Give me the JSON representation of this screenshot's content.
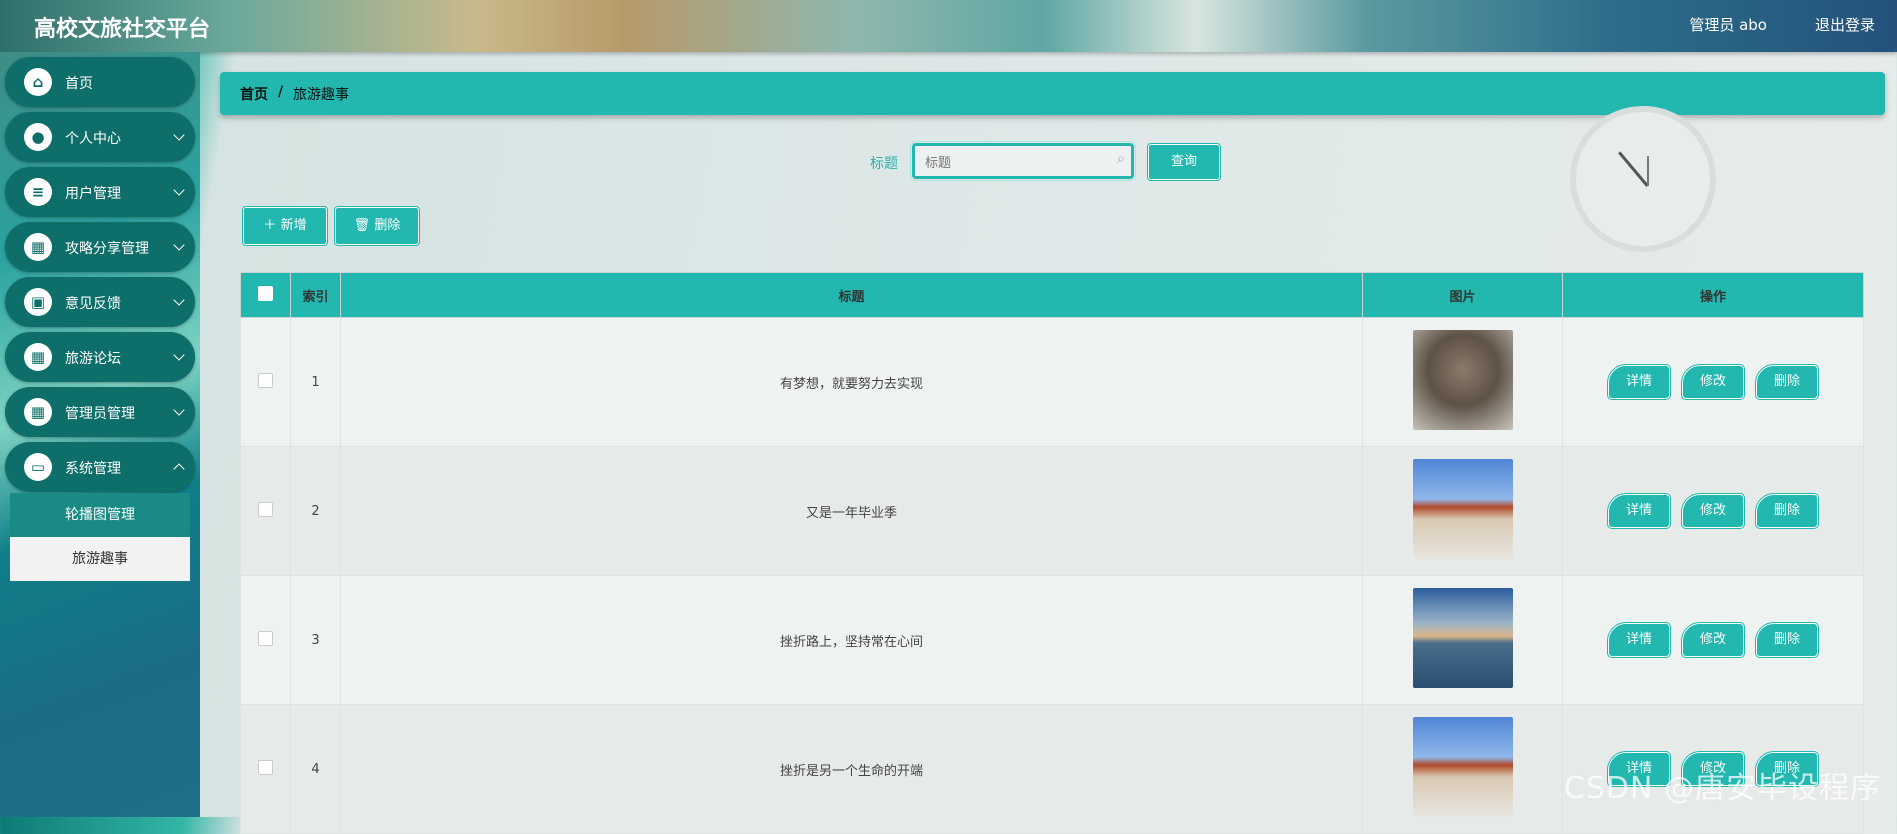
{
  "header": {
    "title": "高校文旅社交平台",
    "admin": "管理员 abo",
    "logout": "退出登录"
  },
  "sidebar": {
    "items": [
      {
        "label": "首页",
        "icon": "home-icon",
        "glyph": "⌂",
        "expandable": false
      },
      {
        "label": "个人中心",
        "icon": "user-icon",
        "glyph": "●",
        "expandable": true
      },
      {
        "label": "用户管理",
        "icon": "list-icon",
        "glyph": "≡",
        "expandable": true
      },
      {
        "label": "攻略分享管理",
        "icon": "grid-icon",
        "glyph": "▦",
        "expandable": true
      },
      {
        "label": "意见反馈",
        "icon": "briefcase-icon",
        "glyph": "▣",
        "expandable": true
      },
      {
        "label": "旅游论坛",
        "icon": "grid-icon",
        "glyph": "▦",
        "expandable": true
      },
      {
        "label": "管理员管理",
        "icon": "grid-icon",
        "glyph": "▦",
        "expandable": true
      },
      {
        "label": "系统管理",
        "icon": "monitor-icon",
        "glyph": "▭",
        "expandable": true
      }
    ],
    "submenu": [
      {
        "label": "轮播图管理"
      },
      {
        "label": "旅游趣事"
      }
    ]
  },
  "breadcrumb": {
    "home": "首页",
    "separator": "/",
    "current": "旅游趣事"
  },
  "search": {
    "label": "标题",
    "placeholder": "标题",
    "value": "",
    "query_button": "查询"
  },
  "actions": {
    "add": "新增",
    "delete": "删除"
  },
  "table": {
    "columns": [
      "",
      "索引",
      "标题",
      "图片",
      "操作"
    ],
    "rows": [
      {
        "index": "1",
        "title": "有梦想，就要努力去实现",
        "image": "pic-a"
      },
      {
        "index": "2",
        "title": "又是一年毕业季",
        "image": "pic-b"
      },
      {
        "index": "3",
        "title": "挫折路上，坚持常在心间",
        "image": "pic-c"
      },
      {
        "index": "4",
        "title": "挫折是另一个生命的开端",
        "image": "pic-b"
      }
    ],
    "row_actions": {
      "detail": "详情",
      "edit": "修改",
      "delete": "删除"
    }
  },
  "watermark": "CSDN @唐安毕设程序",
  "colors": {
    "accent": "#22b8b0",
    "sidebar_item": "#0e6e6a"
  }
}
